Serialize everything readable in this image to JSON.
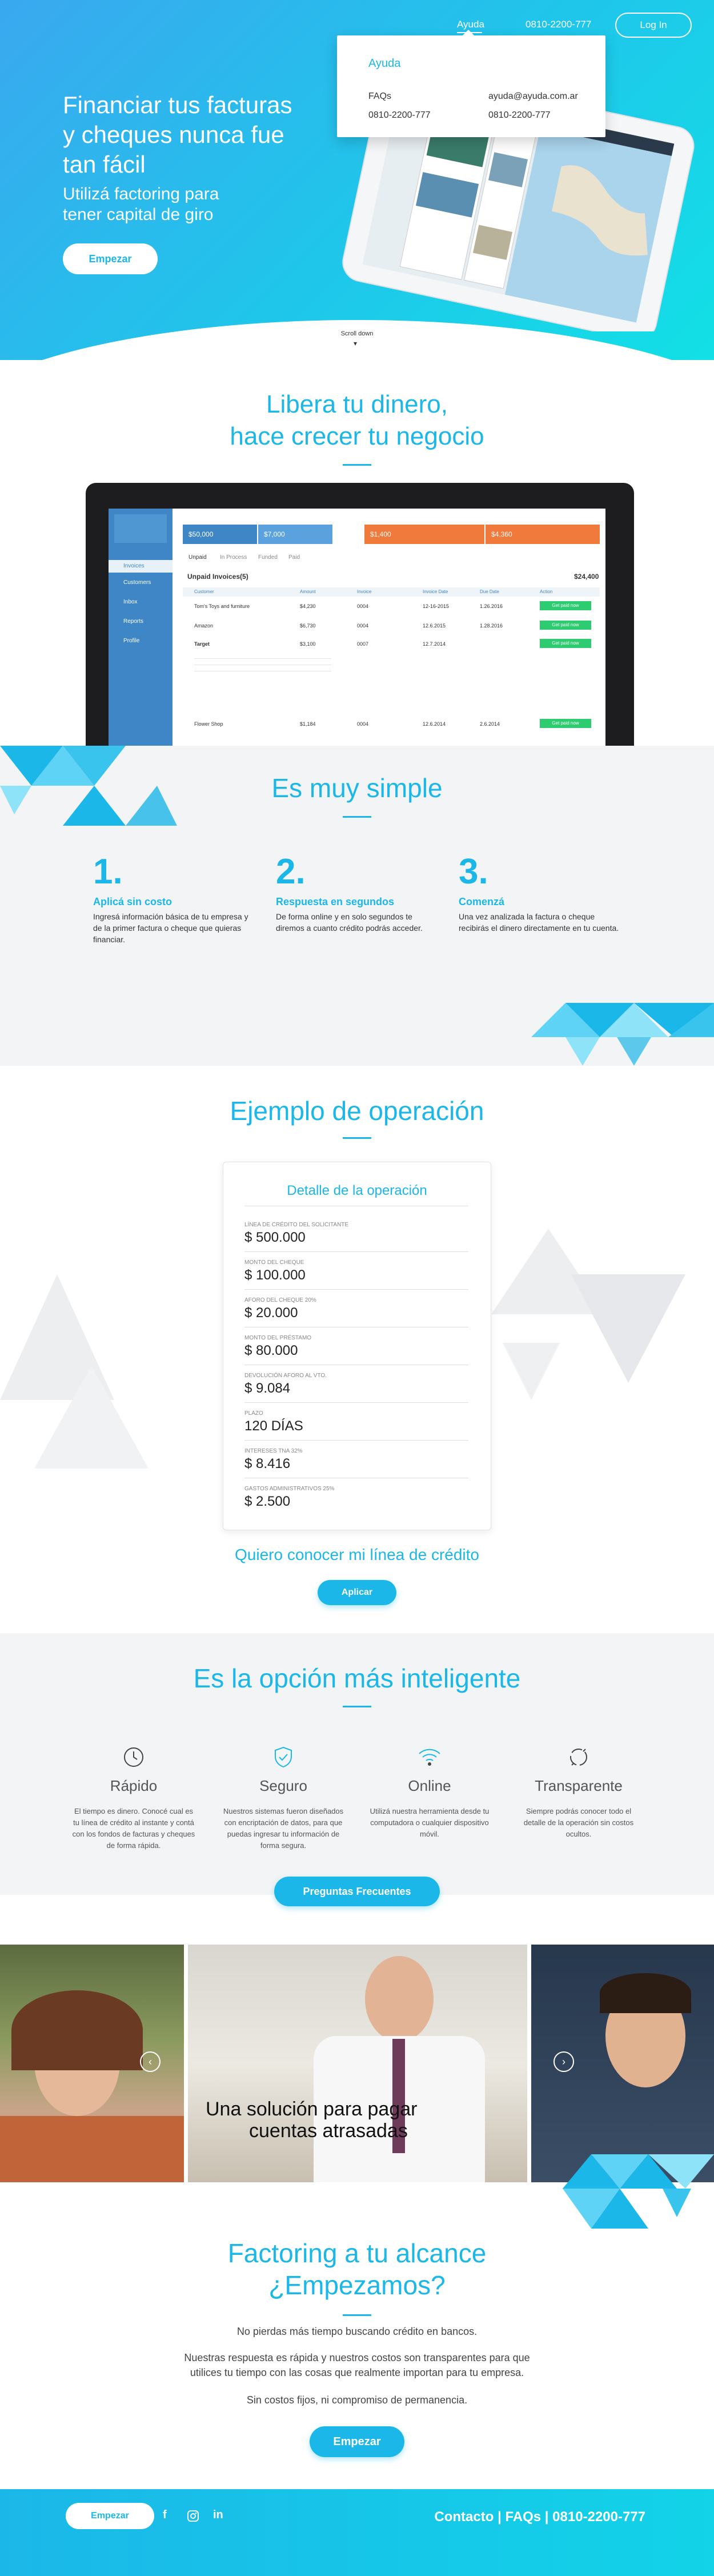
{
  "nav": {
    "ayuda": "Ayuda",
    "phone": "0810-2200-777",
    "login": "Log In"
  },
  "ayuda_popup": {
    "title": "Ayuda",
    "faqs": "FAQs",
    "email": "ayuda@ayuda.com.ar",
    "phone1": "0810-2200-777",
    "phone2": "0810-2200-777"
  },
  "hero": {
    "title_line1": "Financiar tus facturas",
    "title_line2": "y cheques nunca fue",
    "title_line3": "tan fácil",
    "subtitle_line1": "Utilizá factoring para",
    "subtitle_line2": "tener capital de giro",
    "cta": "Empezar",
    "scroll": "Scroll down"
  },
  "libera": {
    "line1": "Libera tu dinero,",
    "line2": "hace crecer tu negocio"
  },
  "dashboard": {
    "brand": "Unpaid Invoices(5)",
    "sidebar": [
      "Invoices",
      "Customers",
      "Inbox",
      "Reports",
      "Profile"
    ],
    "stats": [
      "$50,000",
      "$7,000",
      "$1,400",
      "$4,360"
    ],
    "tabs": [
      "Unpaid",
      "In Process",
      "Funded",
      "Paid"
    ],
    "total": "$24,400",
    "columns": [
      "Customer",
      "Amount",
      "Invoice",
      "Invoice Date",
      "Due Date",
      "Action"
    ],
    "rows": [
      {
        "customer": "Tom's Toys and furniture",
        "amount": "$4,230",
        "invoice": "0004",
        "date": "12-16-2015",
        "due": "1.26.2016"
      },
      {
        "customer": "Amazon",
        "amount": "$6,730",
        "invoice": "0004",
        "date": "12.6.2015",
        "due": "1.28.2016"
      },
      {
        "customer": "Target",
        "amount": "$3,100",
        "invoice": "0007",
        "date": "12.7.2014",
        "due": ""
      },
      {
        "customer": "Flower Shop",
        "amount": "$1,184",
        "invoice": "0004",
        "date": "12.6.2014",
        "due": "2.6.2014"
      }
    ],
    "action": "Get paid now"
  },
  "simple": {
    "title": "Es muy simple",
    "steps": [
      {
        "num": "1.",
        "title": "Aplicá sin costo",
        "text": "Ingresá información básica de tu empresa y de la primer factura o cheque que quieras financiar."
      },
      {
        "num": "2.",
        "title": "Respuesta en segundos",
        "text": "De forma online y en solo segundos te diremos a cuanto crédito podrás acceder."
      },
      {
        "num": "3.",
        "title": "Comenzá",
        "text": "Una vez analizada la factura o cheque recibirás el dinero directamente en tu cuenta."
      }
    ]
  },
  "ejemplo": {
    "title": "Ejemplo de operación",
    "card_title": "Detalle de la operación",
    "items": [
      {
        "label": "LÍNEA DE CRÉDITO DEL SOLICITANTE",
        "value": "$ 500.000"
      },
      {
        "label": "MONTO DEL CHEQUE",
        "value": "$ 100.000"
      },
      {
        "label": "AFORO DEL CHEQUE 20%",
        "value": "$ 20.000"
      },
      {
        "label": "MONTO DEL PRÉSTAMO",
        "value": "$ 80.000"
      },
      {
        "label": "DEVOLUCIÓN AFORO al VTO.",
        "value": "$ 9.084"
      },
      {
        "label": "PLAZO",
        "value": "120 DÍAS"
      },
      {
        "label": "INTERESES TNA 32%",
        "value": "$ 8.416"
      },
      {
        "label": "GASTOS ADMINISTRATIVOS 25%",
        "value": "$ 2.500"
      }
    ],
    "cta_text": "Quiero conocer mi línea de crédito",
    "cta_button": "Aplicar"
  },
  "inteligente": {
    "title": "Es la opción más inteligente",
    "features": [
      {
        "icon": "clock-icon",
        "title": "Rápido",
        "text": "El tiempo es dinero. Conocé cual es tu línea de crédito al instante y contá con los fondos de facturas y cheques de forma rápida."
      },
      {
        "icon": "shield-check-icon",
        "title": "Seguro",
        "text": "Nuestros sistemas fueron diseñados con encriptación de datos, para que puedas ingresar tu información de forma segura."
      },
      {
        "icon": "wifi-icon",
        "title": "Online",
        "text": "Utilizá nuestra herramienta desde tu computadora o cualquier dispositivo móvil."
      },
      {
        "icon": "transparency-icon",
        "title": "Transparente",
        "text": "Siempre podrás conocer todo el detalle de la operación sin costos ocultos."
      }
    ],
    "cta": "Preguntas Frecuentes"
  },
  "testimonial": {
    "quote_line1": "Una solución para pagar",
    "quote_line2": "cuentas atrasadas"
  },
  "factoring": {
    "title_line1": "Factoring a tu alcance",
    "title_line2": "¿Empezamos?",
    "p1": "No pierdas más tiempo buscando crédito en bancos.",
    "p2_line1": "Nuestras respuesta es rápida y nuestros costos son transparentes para que",
    "p2_line2": "utilices tu tiempo con las cosas que realmente importan para tu empresa.",
    "p3": "Sin costos fijos, ni compromiso de permanencia.",
    "cta": "Empezar"
  },
  "footer": {
    "cta": "Empezar",
    "links": "Contacto | FAQs | 0810-2200-777"
  },
  "colors": {
    "accent": "#1bb7e8",
    "orange": "#f07a3c",
    "green": "#2ecc71"
  }
}
